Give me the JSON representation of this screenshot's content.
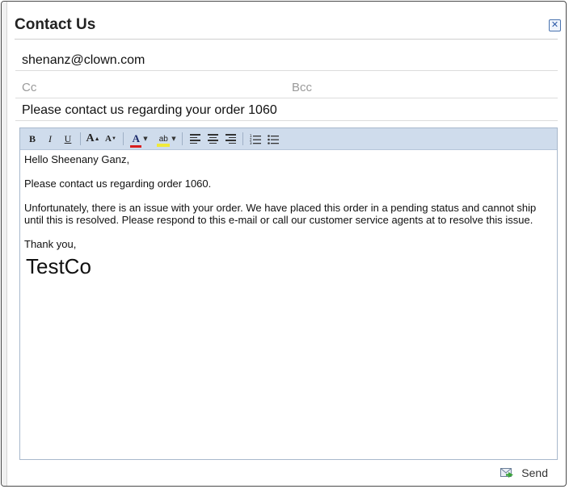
{
  "dialog": {
    "title": "Contact Us"
  },
  "fields": {
    "to": "shenanz@clown.com",
    "cc_placeholder": "Cc",
    "bcc_placeholder": "Bcc",
    "subject": "Please contact us regarding your order 1060"
  },
  "toolbar": {
    "bold": "B",
    "italic": "I",
    "underline": "U",
    "grow": "A",
    "shrink": "A",
    "font_color": "A",
    "highlight": "ab",
    "icons": [
      "bold-icon",
      "italic-icon",
      "underline-icon",
      "font-size-increase-icon",
      "font-size-decrease-icon",
      "font-color-icon",
      "highlight-icon",
      "align-left-icon",
      "align-center-icon",
      "align-right-icon",
      "ordered-list-icon",
      "unordered-list-icon"
    ],
    "colors": {
      "font_color": "#d81e1e",
      "highlight": "#f0ea3a"
    }
  },
  "message": {
    "greeting": "Hello Sheenany Ganz,",
    "line1": "Please contact us regarding order 1060.",
    "line2": "Unfortunately, there is an issue with your order. We have placed this order in a pending status and cannot ship until this is resolved. Please respond to this e-mail or call our customer service agents at to resolve this issue.",
    "closing": "Thank you,",
    "signature": "TestCo"
  },
  "footer": {
    "send_label": "Send"
  }
}
